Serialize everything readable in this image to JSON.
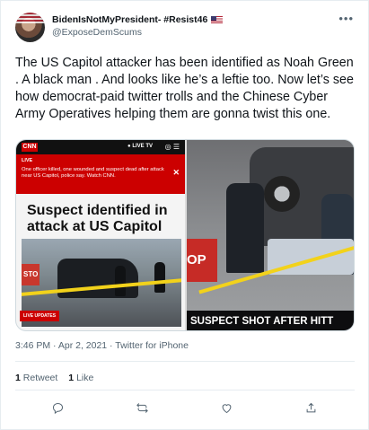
{
  "author": {
    "display_name": "BidenIsNotMyPresident- #Resist46",
    "handle": "@ExposeDemScums",
    "flag_icon": "us-flag-icon"
  },
  "tweet": {
    "text": "The US Capitol attacker has been identified as Noah Green . A black man . And looks like he’s a leftie too. Now let’s see how democrat-paid twitter trolls and the Chinese Cyber Army Operatives helping them are gonna twist this one.",
    "more_label": "•••"
  },
  "media": {
    "left": {
      "logo": "CNN",
      "live_tv": "● LIVE TV",
      "alert_label": "LIVE",
      "alert_text": "One officer killed, one wounded and suspect dead after attack near US Capitol, police say. Watch CNN.",
      "headline": "Suspect identified in attack at US Capitol",
      "stop_text": "STO",
      "live_updates": "LIVE UPDATES"
    },
    "right": {
      "stop_text": "OP",
      "chyron": "SUSPECT SHOT AFTER HITT"
    }
  },
  "meta": {
    "timestamp": "3:46 PM · Apr 2, 2021 · Twitter for iPhone"
  },
  "stats": {
    "retweets_count": "1",
    "retweets_label": "Retweet",
    "likes_count": "1",
    "likes_label": "Like"
  },
  "colors": {
    "accent_cnn": "#cc0000",
    "text_secondary": "#536471",
    "divider": "#e6ecf0"
  },
  "actions": [
    "reply-icon",
    "retweet-icon",
    "like-icon",
    "share-icon"
  ]
}
